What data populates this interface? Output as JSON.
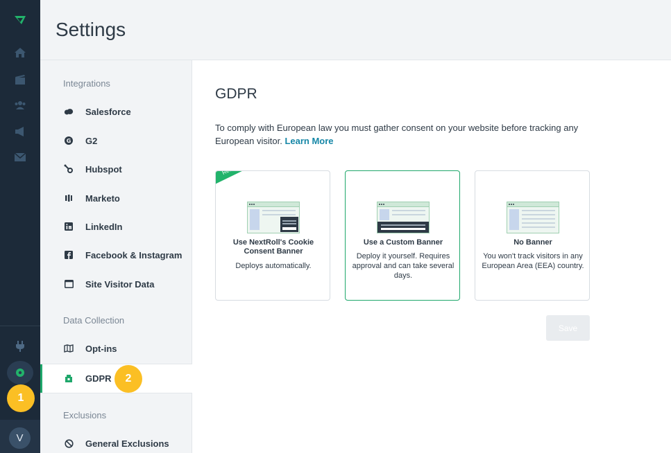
{
  "rail": {
    "avatar_initial": "V",
    "icons": [
      "logo-icon",
      "home-icon",
      "campaigns-icon",
      "audiences-icon",
      "megaphone-icon",
      "email-icon",
      "plug-icon",
      "gear-icon"
    ]
  },
  "badges": {
    "one": "1",
    "two": "2"
  },
  "header": {
    "title": "Settings"
  },
  "subnav": {
    "integrations_label": "Integrations",
    "integrations": [
      {
        "label": "Salesforce",
        "icon": "salesforce-icon"
      },
      {
        "label": "G2",
        "icon": "g2-icon"
      },
      {
        "label": "Hubspot",
        "icon": "hubspot-icon"
      },
      {
        "label": "Marketo",
        "icon": "marketo-icon"
      },
      {
        "label": "LinkedIn",
        "icon": "linkedin-icon"
      },
      {
        "label": "Facebook & Instagram",
        "icon": "facebook-icon"
      },
      {
        "label": "Site Visitor Data",
        "icon": "browser-window-icon"
      }
    ],
    "data_collection_label": "Data Collection",
    "data_collection": [
      {
        "label": "Opt-ins",
        "icon": "map-icon"
      },
      {
        "label": "GDPR",
        "icon": "shield-icon"
      }
    ],
    "exclusions_label": "Exclusions",
    "exclusions": [
      {
        "label": "General Exclusions",
        "icon": "block-icon"
      }
    ]
  },
  "main": {
    "title": "GDPR",
    "description": "To comply with European law you must gather consent on your website before tracking any European visitor.",
    "learn_more": "Learn More",
    "cards": [
      {
        "ribbon": "Recommended",
        "title": "Use NextRoll's Cookie Consent Banner",
        "description": "Deploys automatically."
      },
      {
        "title": "Use a Custom Banner",
        "description": "Deploy it yourself. Requires approval and can take several days."
      },
      {
        "title": "No Banner",
        "description": "You won't track visitors in any European Area (EEA) country."
      }
    ],
    "save_label": "Save"
  },
  "colors": {
    "rail": "#1c2a39",
    "accent_green": "#1fa76b",
    "link": "#1687a7",
    "badge": "#fbbf24"
  }
}
